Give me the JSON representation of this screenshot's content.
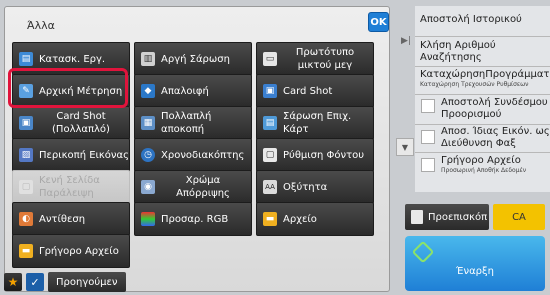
{
  "panel": {
    "title": "Άλλα",
    "ok_label": "OK"
  },
  "buttons": [
    {
      "label": "Κατασκ. Εργ.",
      "icon": "job-build-icon"
    },
    {
      "label": "Αργή Σάρωση",
      "icon": "slow-scan-icon"
    },
    {
      "label": "Πρωτότυπο μικτού μεγ",
      "icon": "mixed-size-icon"
    },
    {
      "label": "Αρχική Μέτρηση",
      "icon": "original-count-icon"
    },
    {
      "label": "Απαλοιφή",
      "icon": "erase-icon"
    },
    {
      "label": "Card Shot",
      "icon": "card-shot-icon"
    },
    {
      "label": "Card Shot (Πολλαπλό)",
      "icon": "card-shot-multi-icon"
    },
    {
      "label": "Πολλαπλή αποκοπή",
      "icon": "multi-crop-icon"
    },
    {
      "label": "Σάρωση Επιχ. Κάρτ",
      "icon": "business-card-scan-icon"
    },
    {
      "label": "Περικοπή Εικόνας",
      "icon": "image-crop-icon"
    },
    {
      "label": "Χρονοδιακόπτης",
      "icon": "timer-icon"
    },
    {
      "label": "Ρύθμιση Φόντου",
      "icon": "background-adjust-icon"
    },
    {
      "label": "Κενή Σελίδα Παράλειψη",
      "icon": "blank-page-skip-icon"
    },
    {
      "label": "Χρώμα Απόρριψης",
      "icon": "color-dropout-icon"
    },
    {
      "label": "Οξύτητα",
      "icon": "sharpness-icon"
    },
    {
      "label": "Αντίθεση",
      "icon": "contrast-icon"
    },
    {
      "label": "Προσαρ. RGB",
      "icon": "rgb-adjust-icon"
    },
    {
      "label": "Αρχείο",
      "icon": "folder-icon"
    },
    {
      "label": "Γρήγορο Αρχείο",
      "icon": "quick-file-icon"
    }
  ],
  "bottom": {
    "previous_label": "Προηγούμεν"
  },
  "right_panel": {
    "send_history": "Αποστολή Ιστορικού",
    "address_search": "Κλήση Αριθμού Αναζήτησης",
    "program_register": "ΚαταχώρησηΠρογράμματος",
    "program_register_sub": "Καταχώρηση Τρεχουσών Ρυθμίσεων",
    "send_same_dest": "Αποστολή Συνδέσμου Προορισμού",
    "send_same_image": "Αποσ. Ίδιας Εικόν. ως Διεύθυνση Φαξ",
    "quick_file": "Γρήγορο Αρχείο",
    "quick_file_sub": "Προσωρινή Αποθήκ Δεδομέν"
  },
  "actions": {
    "preview": "Προεπισκόπ",
    "ca": "CA",
    "start": "Έναρξη"
  }
}
